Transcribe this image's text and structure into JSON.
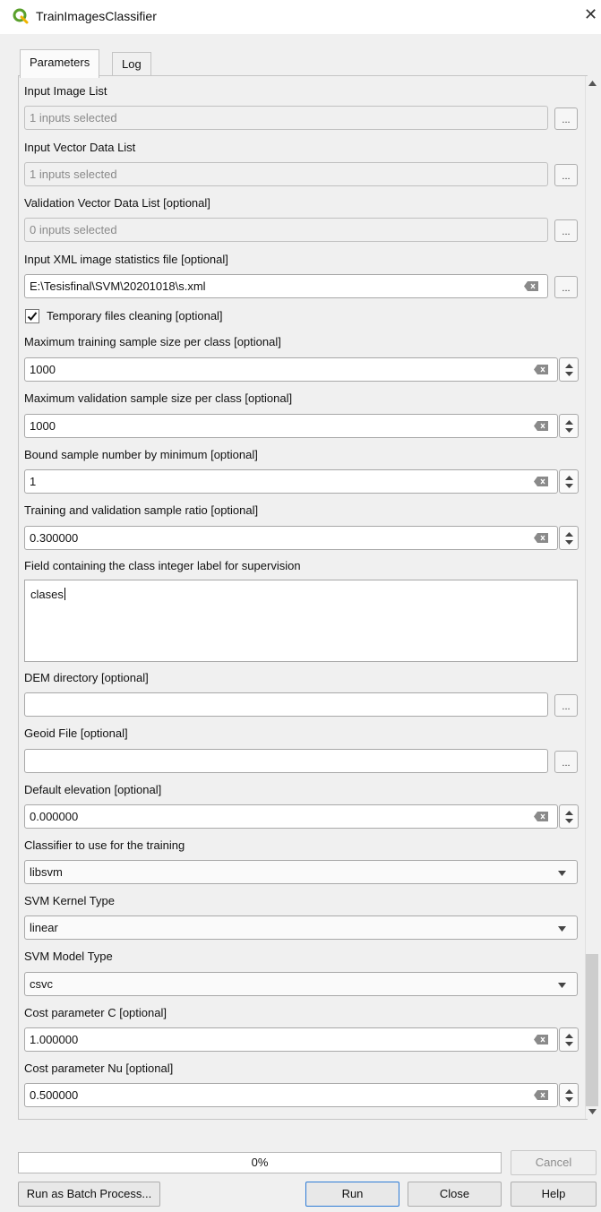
{
  "window": {
    "title": "TrainImagesClassifier",
    "close_glyph": "✕"
  },
  "tabs": [
    {
      "label": "Parameters"
    },
    {
      "label": "Log"
    }
  ],
  "ellipsis_label": "...",
  "params": {
    "input_image_list": {
      "label": "Input Image List",
      "value": "1 inputs selected"
    },
    "input_vector_data_list": {
      "label": "Input Vector Data List",
      "value": "1 inputs selected"
    },
    "validation_vector_data_list": {
      "label": "Validation Vector Data List [optional]",
      "value": "0 inputs selected"
    },
    "input_xml_stats": {
      "label": "Input XML image statistics file [optional]",
      "value": "E:\\Tesisfinal\\SVM\\20201018\\s.xml"
    },
    "temp_cleaning": {
      "label": "Temporary files cleaning [optional]",
      "checked": true
    },
    "max_training_sample": {
      "label": "Maximum training sample size per class [optional]",
      "value": "1000"
    },
    "max_validation_sample": {
      "label": "Maximum validation sample size per class [optional]",
      "value": "1000"
    },
    "bound_sample_minimum": {
      "label": "Bound sample number by minimum [optional]",
      "value": "1"
    },
    "sample_ratio": {
      "label": "Training and validation sample ratio [optional]",
      "value": "0.300000"
    },
    "class_field": {
      "label": "Field containing the class integer label for supervision",
      "value": "clases"
    },
    "dem_directory": {
      "label": "DEM directory [optional]",
      "value": ""
    },
    "geoid_file": {
      "label": "Geoid File [optional]",
      "value": ""
    },
    "default_elevation": {
      "label": "Default elevation [optional]",
      "value": "0.000000"
    },
    "classifier": {
      "label": "Classifier to use for the training",
      "value": "libsvm"
    },
    "svm_kernel": {
      "label": "SVM Kernel Type",
      "value": "linear"
    },
    "svm_model": {
      "label": "SVM Model Type",
      "value": "csvc"
    },
    "cost_c": {
      "label": "Cost parameter C [optional]",
      "value": "1.000000"
    },
    "cost_nu": {
      "label": "Cost parameter Nu [optional]",
      "value": "0.500000"
    }
  },
  "progress": {
    "text": "0%",
    "fraction": 0
  },
  "buttons": {
    "cancel": "Cancel",
    "batch": "Run as Batch Process...",
    "run": "Run",
    "close": "Close",
    "help": "Help"
  }
}
